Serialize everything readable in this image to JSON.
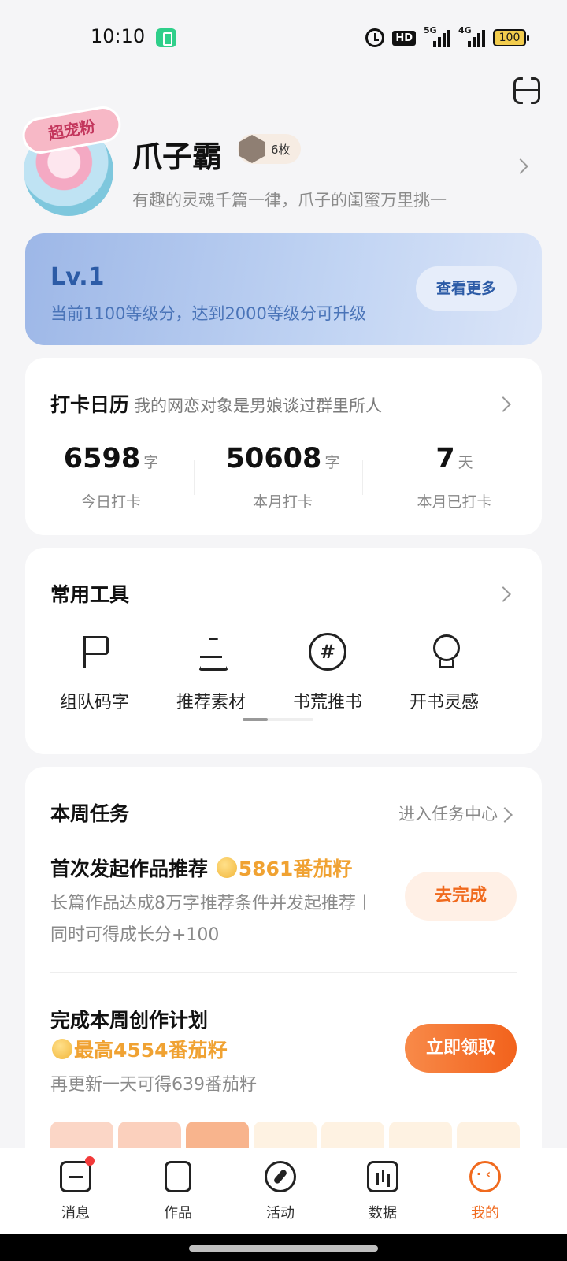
{
  "status_bar": {
    "time": "10:10",
    "network_1": "5G",
    "network_2": "4G",
    "hd_label": "HD",
    "battery": "100"
  },
  "profile": {
    "avatar_badge": "超宠粉",
    "username": "爪子霸",
    "medal_count": "6枚",
    "bio": "有趣的灵魂千篇一律，爪子的闺蜜万里挑一"
  },
  "level": {
    "title": "Lv.1",
    "desc": "当前1100等级分，达到2000等级分可升级",
    "button": "查看更多"
  },
  "checkin": {
    "title": "打卡日历",
    "subtitle": "我的网恋对象是男娘谈过群里所人",
    "stats": [
      {
        "value": "6598",
        "unit": "字",
        "label": "今日打卡"
      },
      {
        "value": "50608",
        "unit": "字",
        "label": "本月打卡"
      },
      {
        "value": "7",
        "unit": "天",
        "label": "本月已打卡"
      }
    ]
  },
  "tools": {
    "title": "常用工具",
    "items": [
      {
        "label": "组队码字",
        "icon": "flag-icon"
      },
      {
        "label": "推荐素材",
        "icon": "flask-icon"
      },
      {
        "label": "书荒推书",
        "icon": "hashtag-icon"
      },
      {
        "label": "开书灵感",
        "icon": "lightbulb-icon"
      }
    ]
  },
  "weekly_tasks": {
    "title": "本周任务",
    "link": "进入任务中心",
    "tasks": [
      {
        "name": "首次发起作品推荐",
        "reward": "5861番茄籽",
        "desc": "长篇作品达成8万字推荐条件并发起推荐丨同时可得成长分+100",
        "button": "去完成"
      },
      {
        "name": "完成本周创作计划",
        "reward": "最高4554番茄籽",
        "desc": "再更新一天可得639番茄籽",
        "button": "立即领取"
      }
    ]
  },
  "bottom_nav": [
    {
      "label": "消息",
      "icon": "message-icon"
    },
    {
      "label": "作品",
      "icon": "works-icon"
    },
    {
      "label": "活动",
      "icon": "compass-icon"
    },
    {
      "label": "数据",
      "icon": "chart-icon"
    },
    {
      "label": "我的",
      "icon": "profile-icon",
      "active": true
    }
  ],
  "colors": {
    "accent": "#f06a1e",
    "reward": "#f0a232",
    "level_text": "#2c5ba6"
  }
}
